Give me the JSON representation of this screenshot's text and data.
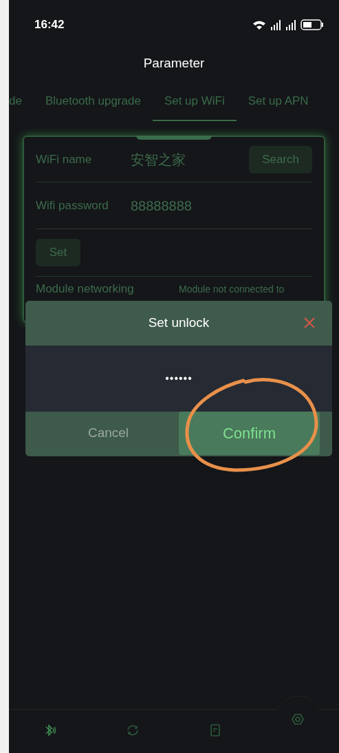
{
  "status_bar": {
    "time": "16:42"
  },
  "title": "Parameter",
  "tabs": [
    {
      "label": "de",
      "selected": false
    },
    {
      "label": "Bluetooth upgrade",
      "selected": false
    },
    {
      "label": "Set up WiFi",
      "selected": true
    },
    {
      "label": "Set up APN",
      "selected": false
    }
  ],
  "form": {
    "wifi_name": {
      "label": "WiFi name",
      "value": "安智之家"
    },
    "search_button": "Search",
    "password": {
      "label": "Wifi password",
      "value": "88888888"
    },
    "set_button": "Set",
    "module_networking": {
      "label": "Module networking",
      "value": "Module not connected to"
    }
  },
  "dialog": {
    "title": "Set unlock",
    "value": "••••••",
    "buttons": [
      {
        "label": "Cancel",
        "kind": "cancel"
      },
      {
        "label": "Confirm",
        "kind": "confirm"
      }
    ]
  },
  "bottom_nav": [
    {
      "kind": "bluetooth",
      "selected": false
    },
    {
      "kind": "sync",
      "selected": false
    },
    {
      "kind": "document",
      "selected": false
    },
    {
      "kind": "settings",
      "selected": true
    }
  ]
}
